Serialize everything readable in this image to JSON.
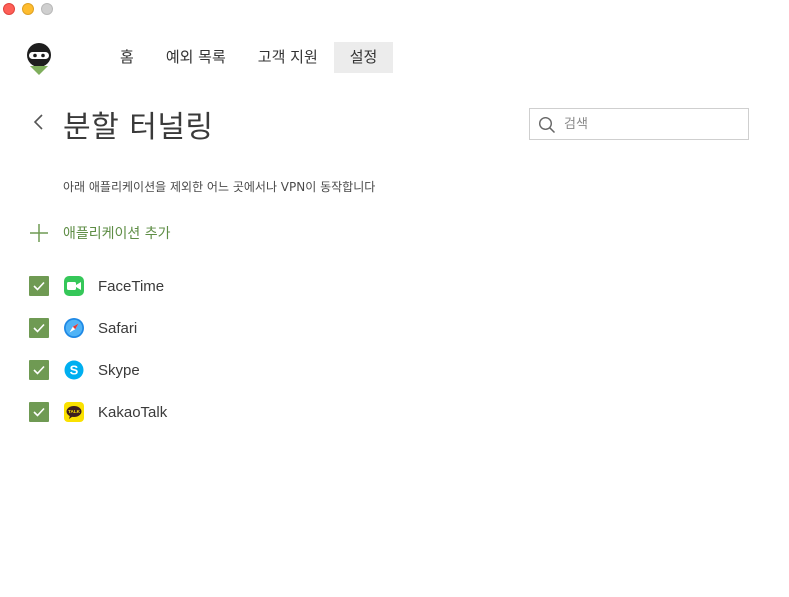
{
  "window": {
    "controls": [
      "close",
      "minimize",
      "zoom"
    ]
  },
  "logo": {
    "icon": "ninja-logo-icon"
  },
  "nav": {
    "items": [
      {
        "label": "홈",
        "active": false
      },
      {
        "label": "예외 목록",
        "active": false
      },
      {
        "label": "고객 지원",
        "active": false
      },
      {
        "label": "설정",
        "active": true
      }
    ]
  },
  "header": {
    "title": "분할 터널링",
    "back_icon": "chevron-left-icon"
  },
  "search": {
    "placeholder": "검색",
    "value": ""
  },
  "description": "아래 애플리케이션을 제외한 어느 곳에서나 VPN이 동작합니다",
  "add_app": {
    "label": "애플리케이션 추가",
    "icon": "plus-icon"
  },
  "apps": [
    {
      "name": "FaceTime",
      "checked": true,
      "icon": "facetime-icon"
    },
    {
      "name": "Safari",
      "checked": true,
      "icon": "safari-icon"
    },
    {
      "name": "Skype",
      "checked": true,
      "icon": "skype-icon"
    },
    {
      "name": "KakaoTalk",
      "checked": true,
      "icon": "kakaotalk-icon",
      "icon_text": "TALK"
    }
  ],
  "colors": {
    "accent_green": "#6f9a53",
    "add_label_green": "#5e8d45",
    "nav_active_bg": "#ececec"
  }
}
